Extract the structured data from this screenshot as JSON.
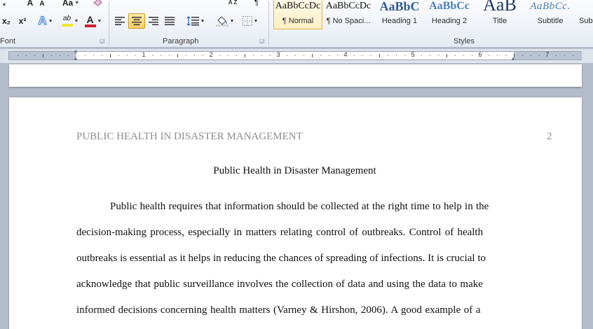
{
  "ribbon": {
    "font": {
      "label": "Font",
      "subscript": "x₂",
      "superscript": "x²",
      "text_effects": "A",
      "highlight": "ab",
      "font_color": "A",
      "grow_font": "A",
      "shrink_font": "A",
      "change_case": "Aa",
      "highlight_color": "#f4e533",
      "font_color_bar": "#d0202a"
    },
    "paragraph": {
      "label": "Paragraph",
      "sort": "A Z"
    },
    "styles": {
      "label": "Styles",
      "items": [
        {
          "sample": "AaBbCcDc",
          "name": "¶ Normal",
          "selected": true
        },
        {
          "sample": "AaBbCcDc",
          "name": "¶ No Spaci..."
        },
        {
          "sample": "AaBbC",
          "name": "Heading 1"
        },
        {
          "sample": "AaBbCc",
          "name": "Heading 2"
        },
        {
          "sample": "AaB",
          "name": "Title"
        },
        {
          "sample": "AaBbCc.",
          "name": "Subtitle"
        },
        {
          "sample": "",
          "name": "Sub"
        }
      ]
    }
  },
  "ruler": {
    "numbers": [
      "1",
      "2",
      "3",
      "4",
      "5",
      "6",
      "7"
    ]
  },
  "document": {
    "header": "PUBLIC HEALTH IN DISASTER MANAGEMENT",
    "page_number": "2",
    "title": "Public Health in Disaster Management",
    "lines": [
      "Public health requires that information should be collected at the right time to help in the",
      "decision-making process, especially in matters relating control of outbreaks. Control of health",
      "outbreaks is essential as it helps in reducing the chances of spreading of infections. It is crucial to",
      "acknowledge that public surveillance involves the collection of data and using the data to make",
      "informed decisions concerning health matters (Varney & Hirshon, 2006). A good example of a"
    ]
  }
}
